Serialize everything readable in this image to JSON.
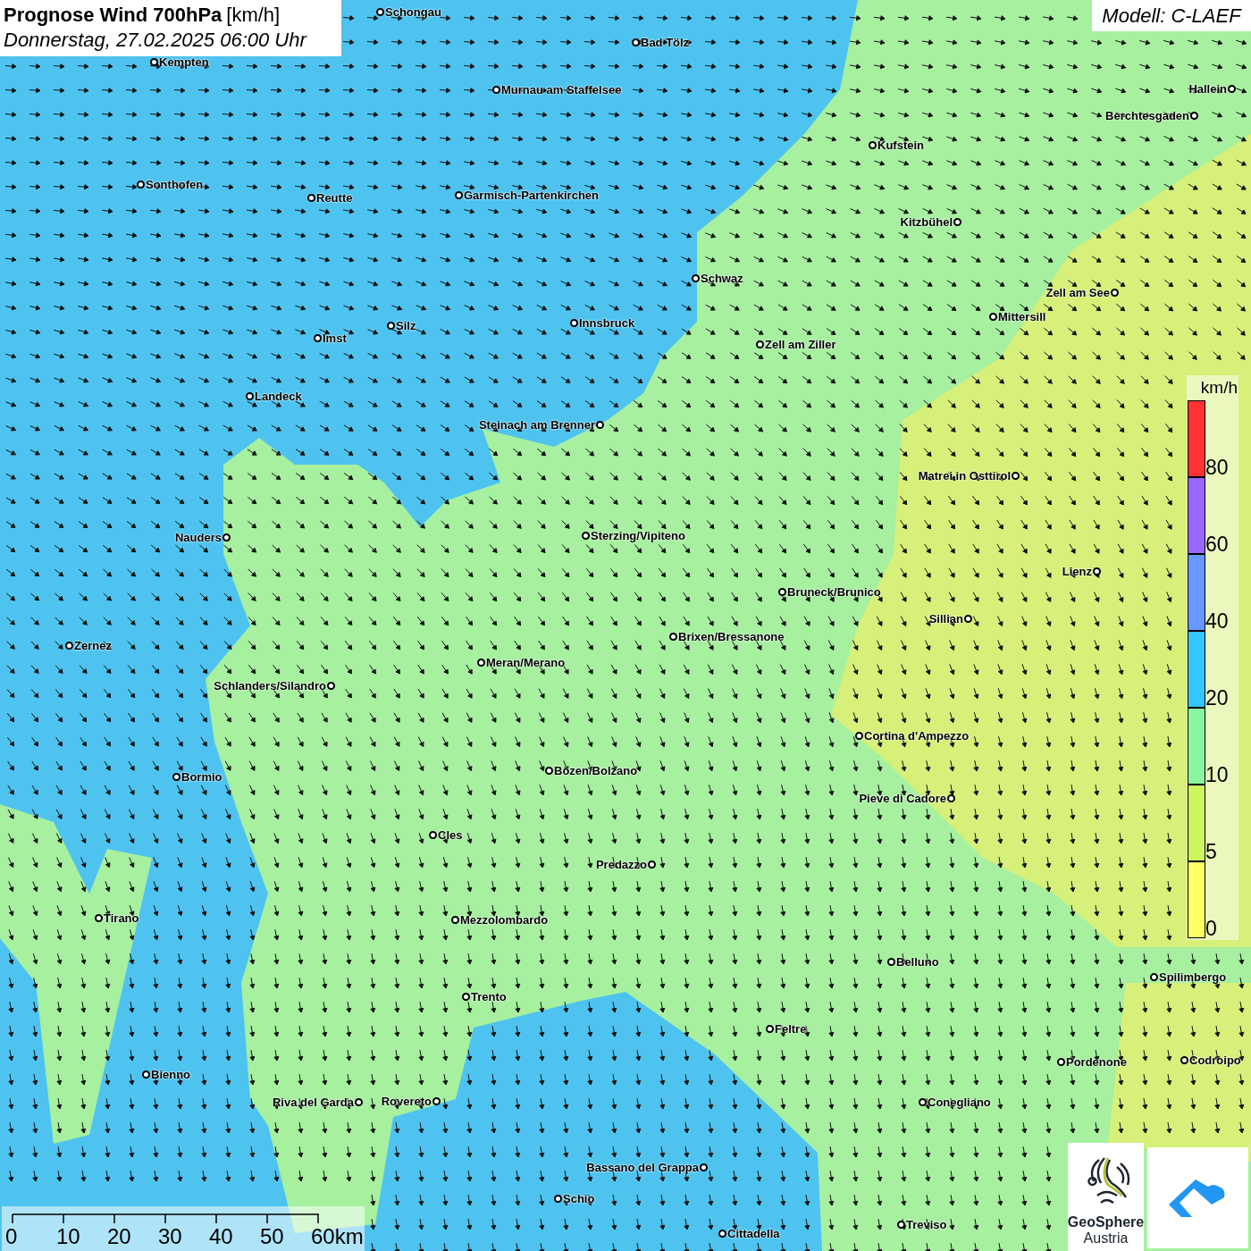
{
  "title": {
    "main": "Prognose Wind 700hPa",
    "unit": "[km/h]",
    "date": "Donnerstag, 27.02.2025 06:00 Uhr"
  },
  "model": "Modell: C-LAEF",
  "cities": [
    {
      "name": "Schongau"
    },
    {
      "name": "Bad Tölz"
    },
    {
      "name": "Kempten"
    },
    {
      "name": "Murnau am Staffelsee"
    },
    {
      "name": "Hallein"
    },
    {
      "name": "Berchtesgaden"
    },
    {
      "name": "Kufstein"
    },
    {
      "name": "Sonthofen"
    },
    {
      "name": "Reutte"
    },
    {
      "name": "Garmisch-Partenkirchen"
    },
    {
      "name": "Kitzbühel"
    },
    {
      "name": "Schwaz"
    },
    {
      "name": "Zell am See"
    },
    {
      "name": "Innsbruck"
    },
    {
      "name": "Mittersill"
    },
    {
      "name": "Silz"
    },
    {
      "name": "Zell am Ziller"
    },
    {
      "name": "Imst"
    },
    {
      "name": "Landeck"
    },
    {
      "name": "Steinach am Brenner"
    },
    {
      "name": "Matrei in Osttirol"
    },
    {
      "name": "Nauders"
    },
    {
      "name": "Sterzing/Vipiteno"
    },
    {
      "name": "Lienz"
    },
    {
      "name": "Bruneck/Brunico"
    },
    {
      "name": "Sillian"
    },
    {
      "name": "Brixen/Bressanone"
    },
    {
      "name": "Zernez"
    },
    {
      "name": "Meran/Merano"
    },
    {
      "name": "Schlanders/Silandro"
    },
    {
      "name": "Cortina d'Ampezzo"
    },
    {
      "name": "Bozen/Bolzano"
    },
    {
      "name": "Bormio"
    },
    {
      "name": "Pieve di Cadore"
    },
    {
      "name": "Cles"
    },
    {
      "name": "Predazzo"
    },
    {
      "name": "Tirano"
    },
    {
      "name": "Mezzolombardo"
    },
    {
      "name": "Belluno"
    },
    {
      "name": "Spilimbergo"
    },
    {
      "name": "Trento"
    },
    {
      "name": "Feltre"
    },
    {
      "name": "Pordenone"
    },
    {
      "name": "Codroipo"
    },
    {
      "name": "Bienno"
    },
    {
      "name": "Riva del Garda"
    },
    {
      "name": "Rovereto"
    },
    {
      "name": "Conegliano"
    },
    {
      "name": "Bassano del Grappa"
    },
    {
      "name": "Schio"
    },
    {
      "name": "Treviso"
    },
    {
      "name": "Cittadella"
    }
  ],
  "legend": {
    "unit": "km/h",
    "bands": [
      {
        "label": "80",
        "color": "#ff3333"
      },
      {
        "label": "60",
        "color": "#9966ff"
      },
      {
        "label": "40",
        "color": "#6699ff"
      },
      {
        "label": "20",
        "color": "#33c6ff"
      },
      {
        "label": "10",
        "color": "#88f5a0"
      },
      {
        "label": "5",
        "color": "#ccf560"
      },
      {
        "label": "0",
        "color": "#ffff66"
      }
    ]
  },
  "scale_bar": {
    "labels": [
      "0",
      "10",
      "20",
      "30",
      "40",
      "50",
      "60km"
    ]
  },
  "logo": {
    "line_1": "GeoSphere",
    "line_2": "Austria"
  }
}
